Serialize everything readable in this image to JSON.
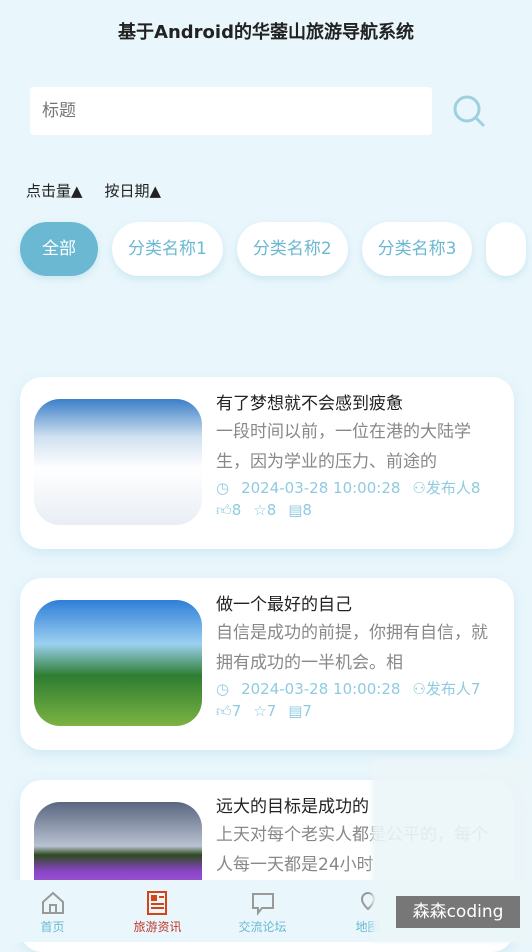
{
  "header": {
    "title": "基于Android的华蓥山旅游导航系统"
  },
  "search": {
    "placeholder": "标题"
  },
  "sort": {
    "clicks": "点击量▲",
    "date": "按日期▲"
  },
  "categories": [
    "全部",
    "分类名称1",
    "分类名称2",
    "分类名称3"
  ],
  "articles": [
    {
      "title": "有了梦想就不会感到疲惫",
      "desc": "一段时间以前，一位在港的大陆学生，因为学业的压力、前途的",
      "time": "2024-03-28 10:00:28",
      "author": "发布人8",
      "likes": "8",
      "favs": "8",
      "comments": "8"
    },
    {
      "title": "做一个最好的自己",
      "desc": "自信是成功的前提，你拥有自信，就拥有成功的一半机会。相",
      "time": "2024-03-28 10:00:28",
      "author": "发布人7",
      "likes": "7",
      "favs": "7",
      "comments": "7"
    },
    {
      "title": "远大的目标是成功的",
      "desc": "上天对每个老实人都是公平的，每个人每一天都是24小时"
    }
  ],
  "nav": [
    "首页",
    "旅游资讯",
    "交流论坛",
    "地图"
  ],
  "watermark": "森森coding",
  "colors": {
    "accent": "#6bb8d3",
    "active_nav": "#c0392b"
  }
}
